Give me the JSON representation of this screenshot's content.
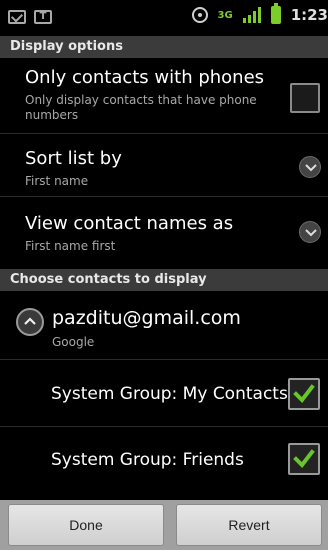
{
  "status_bar": {
    "clock": "1:23",
    "network": "3G",
    "icons": [
      "mail-icon",
      "t-icon",
      "gps-icon",
      "3g-icon",
      "signal-icon",
      "battery-icon"
    ]
  },
  "display_options": {
    "header": "Display options",
    "only_phones": {
      "title": "Only contacts with phones",
      "summary": "Only display contacts that have phone numbers",
      "checked": false
    },
    "sort_by": {
      "title": "Sort list by",
      "summary": "First name"
    },
    "view_names": {
      "title": "View contact names as",
      "summary": "First name first"
    }
  },
  "choose_contacts": {
    "header": "Choose contacts to display",
    "account": {
      "email": "pazditu@gmail.com",
      "type": "Google",
      "expanded": true
    },
    "groups": [
      {
        "label": "System Group: My Contacts",
        "checked": true
      },
      {
        "label": "System Group: Friends",
        "checked": true
      }
    ]
  },
  "buttons": {
    "done": "Done",
    "revert": "Revert"
  },
  "colors": {
    "checkmark": "#6ac52a",
    "section_header_bg": "#3b3b3b",
    "background": "#000000"
  }
}
